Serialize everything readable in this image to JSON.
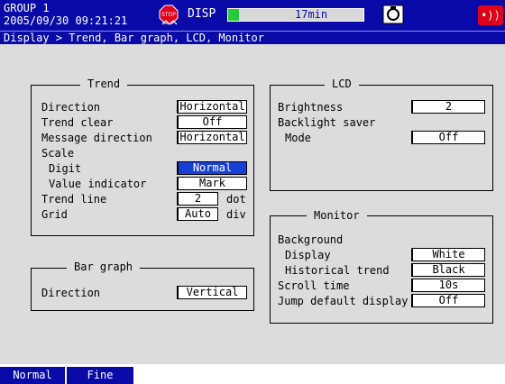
{
  "status": {
    "group": "GROUP 1",
    "datetime": "2005/09/30 09:21:21",
    "mode": "DISP",
    "memory_time": "17min",
    "memory_fill_fraction": 0.08,
    "icons": [
      "stop-icon",
      "storage-media-icon",
      "alarm-icon"
    ]
  },
  "breadcrumb": "Display > Trend, Bar graph, LCD, Monitor",
  "trend": {
    "title": "Trend",
    "direction_label": "Direction",
    "direction": "Horizontal",
    "clear_label": "Trend clear",
    "clear": "Off",
    "msg_dir_label": "Message direction",
    "msg_dir": "Horizontal",
    "scale_label": "Scale",
    "digit_label": "Digit",
    "digit": "Normal",
    "value_ind_label": "Value indicator",
    "value_ind": "Mark",
    "line_label": "Trend line",
    "line": "2",
    "line_unit": "dot",
    "grid_label": "Grid",
    "grid": "Auto",
    "grid_unit": "div"
  },
  "bar_graph": {
    "title": "Bar graph",
    "direction_label": "Direction",
    "direction": "Vertical"
  },
  "lcd": {
    "title": "LCD",
    "brightness_label": "Brightness",
    "brightness": "2",
    "backlight_label": "Backlight saver",
    "mode_label": "Mode",
    "mode": "Off"
  },
  "monitor": {
    "title": "Monitor",
    "background_label": "Background",
    "display_label": "Display",
    "display": "White",
    "hist_label": "Historical trend",
    "hist": "Black",
    "scroll_label": "Scroll time",
    "scroll": "10s",
    "jump_label": "Jump default display",
    "jump": "Off"
  },
  "softkeys": [
    "Normal",
    "Fine"
  ],
  "colors": {
    "bar_blue": "#0a0aa8",
    "panel_gray": "#dcdcdc",
    "selected": "#1a3fd8",
    "memory_green": "#22cc33",
    "alarm_red": "#e00018"
  }
}
